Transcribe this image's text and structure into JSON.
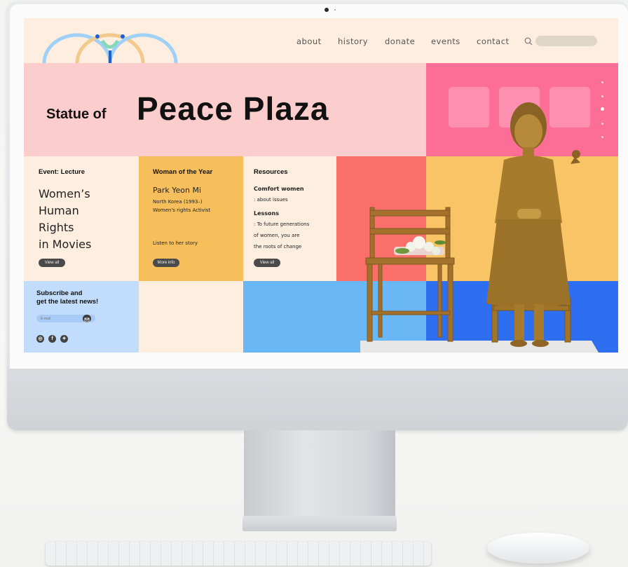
{
  "nav": {
    "items": [
      "about",
      "history",
      "donate",
      "events",
      "contact"
    ],
    "search_placeholder": ""
  },
  "hero": {
    "title_small": "Statue of",
    "title_large": "Peace Plaza"
  },
  "event": {
    "heading": "Event: Lecture",
    "lines": [
      "Women’s",
      "Human",
      "Rights",
      "in Movies"
    ],
    "button": "View all"
  },
  "woman": {
    "heading": "Woman of the Year",
    "name": "Park Yeon Mi",
    "line1": "North Korea (1993–)",
    "line2": "Women's rights Activist",
    "link": "Listen to her story",
    "button": "More info"
  },
  "resources": {
    "heading": "Resources",
    "item1": "Comfort women",
    "item1_sub": ": about issues",
    "item2": "Lessons",
    "item2_sub1": ": To future generations",
    "item2_sub2": "of women, you are",
    "item2_sub3": "the roots of change",
    "button": "View all"
  },
  "subscribe": {
    "heading_line1": "Subscribe and",
    "heading_line2": "get the latest news!",
    "email_placeholder": "E-mail"
  },
  "icons": {
    "search": "search-icon",
    "mail": "mail-icon",
    "instagram": "instagram-icon",
    "facebook": "facebook-icon",
    "twitter": "twitter-icon"
  },
  "colors": {
    "cream": "#fdeee0",
    "pink": "#fccdcd",
    "hot_pink": "#fd6e96",
    "coral": "#fb6f6b",
    "yellow": "#f9c465",
    "mustard": "#f6bf5c",
    "light_blue": "#c2ddfb",
    "sky_blue": "#69b8f5",
    "royal_blue": "#2d6ff0",
    "bronze": "#a37a2c"
  }
}
